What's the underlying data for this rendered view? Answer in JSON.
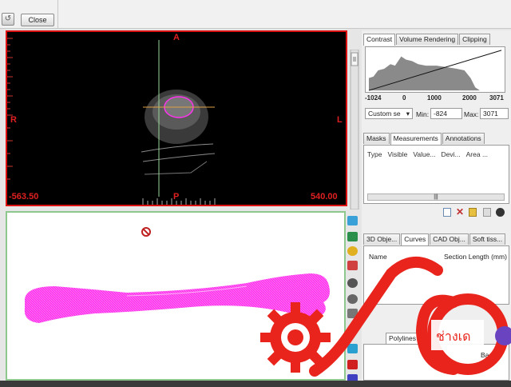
{
  "toolbar": {
    "close_label": "Close"
  },
  "view2d": {
    "label_top": "A",
    "label_bottom": "P",
    "label_left": "R",
    "label_right": "L",
    "coord_left": "-563.50",
    "coord_right": "540.00"
  },
  "contrast_panel": {
    "tabs": [
      "Contrast",
      "Volume Rendering",
      "Clipping"
    ],
    "ticks": [
      "-1024",
      "0",
      "1000",
      "2000",
      "3071"
    ],
    "preset": "Custom se",
    "min_label": "Min:",
    "min_value": "-824",
    "max_label": "Max:",
    "max_value": "3071"
  },
  "measure_panel": {
    "tabs": [
      "Masks",
      "Measurements",
      "Annotations"
    ],
    "columns": [
      "Type",
      "Visible",
      "Value...",
      "Devi...",
      "Area ..."
    ],
    "scroll_grip": "|||"
  },
  "objects_panel": {
    "tabs": [
      "3D Obje...",
      "Curves",
      "CAD Obj...",
      "Soft tiss..."
    ],
    "columns": [
      "Name",
      "Section Length (mm)"
    ]
  },
  "polylines_panel": {
    "tabs": [
      "Polylines"
    ],
    "based_on_label": "Based on"
  },
  "colors": {
    "view2d_border": "#dd1111",
    "view3d_border": "#8fc88f",
    "bone_mesh": "#ff33ee",
    "logo_red": "#e8241c"
  },
  "icons": [
    "slice-view-icon",
    "layers-icon",
    "cube-icon",
    "rotate-icon",
    "eye-icon",
    "forbidden-icon",
    "gear-icon",
    "add-icon",
    "delete-icon"
  ]
}
